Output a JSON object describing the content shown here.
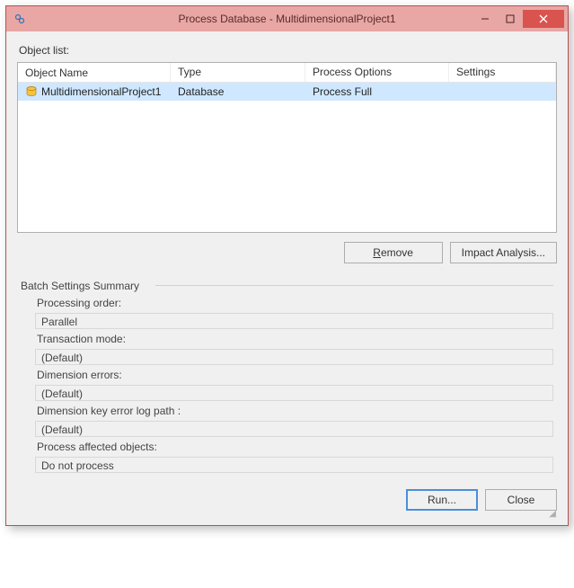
{
  "window": {
    "title": "Process Database - MultidimensionalProject1"
  },
  "object_list_label": "Object list:",
  "columns": {
    "name": "Object Name",
    "type": "Type",
    "options": "Process Options",
    "settings": "Settings"
  },
  "rows": [
    {
      "name": "MultidimensionalProject1",
      "type": "Database",
      "options": "Process Full",
      "settings": ""
    }
  ],
  "buttons": {
    "remove_pre": "",
    "remove_u": "R",
    "remove_post": "emove",
    "impact": "Impact Analysis...",
    "run": "Run...",
    "close": "Close"
  },
  "batch": {
    "legend": "Batch Settings Summary",
    "processing_order_label": "Processing order:",
    "processing_order_value": "Parallel",
    "transaction_mode_label": "Transaction mode:",
    "transaction_mode_value": "(Default)",
    "dimension_errors_label": "Dimension errors:",
    "dimension_errors_value": "(Default)",
    "key_log_label": "Dimension key error log path :",
    "key_log_value": "(Default)",
    "affected_label": "Process affected objects:",
    "affected_value": "Do not process"
  }
}
